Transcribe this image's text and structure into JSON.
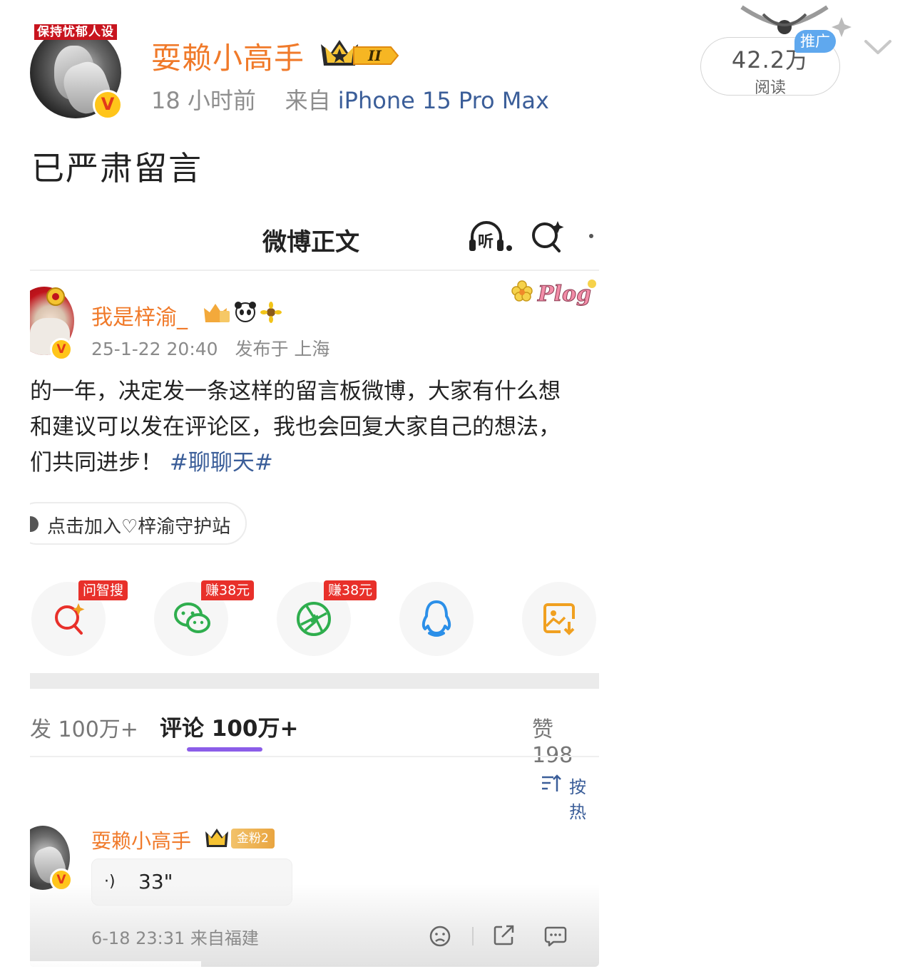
{
  "post": {
    "avatar_tag": "保持忧郁人设",
    "username": "耍赖小高手",
    "crown_level": "II",
    "time": "18 小时前",
    "from_label": "来自",
    "device": "iPhone 15 Pro Max",
    "text": "已严肃留言",
    "read_count": "42.2万",
    "read_label": "阅读",
    "ad_badge": "推广",
    "verified_badge": "V"
  },
  "screenshot": {
    "title": "微博正文",
    "listen_label": "听",
    "original_post": {
      "username": "我是梓渝_",
      "datetime": "25-1-22 20:40",
      "location": "发布于 上海",
      "plog_label": "Plog",
      "lines": [
        "的一年，决定发一条这样的留言板微博，大家有什么想",
        "和建议可以发在评论区，我也会回复大家自己的想法，",
        "们共同进步！"
      ],
      "hashtag": "#聊聊天#",
      "join_label": "点击加入♡梓渝守护站"
    },
    "share_buttons": [
      {
        "icon": "ai-search-icon",
        "tag": "问智搜",
        "color": "#e8302a"
      },
      {
        "icon": "wechat-icon",
        "tag": "赚38元",
        "color": "#2fae4e"
      },
      {
        "icon": "moments-icon",
        "tag": "赚38元",
        "color": "#2fae4e"
      },
      {
        "icon": "qq-icon",
        "tag": "",
        "color": "#2b8fe8"
      },
      {
        "icon": "save-image-icon",
        "tag": "",
        "color": "#f0a020"
      }
    ],
    "tabs": {
      "repost": "发 100万+",
      "comment": "评论 100万+",
      "like": "赞 198"
    },
    "sort_label": "按热",
    "comment": {
      "username": "耍赖小高手",
      "fan_badge": "金粉2",
      "voice_symbol": "·)",
      "voice_duration": "33\"",
      "datetime": "6-18 23:31 来自福建"
    }
  }
}
